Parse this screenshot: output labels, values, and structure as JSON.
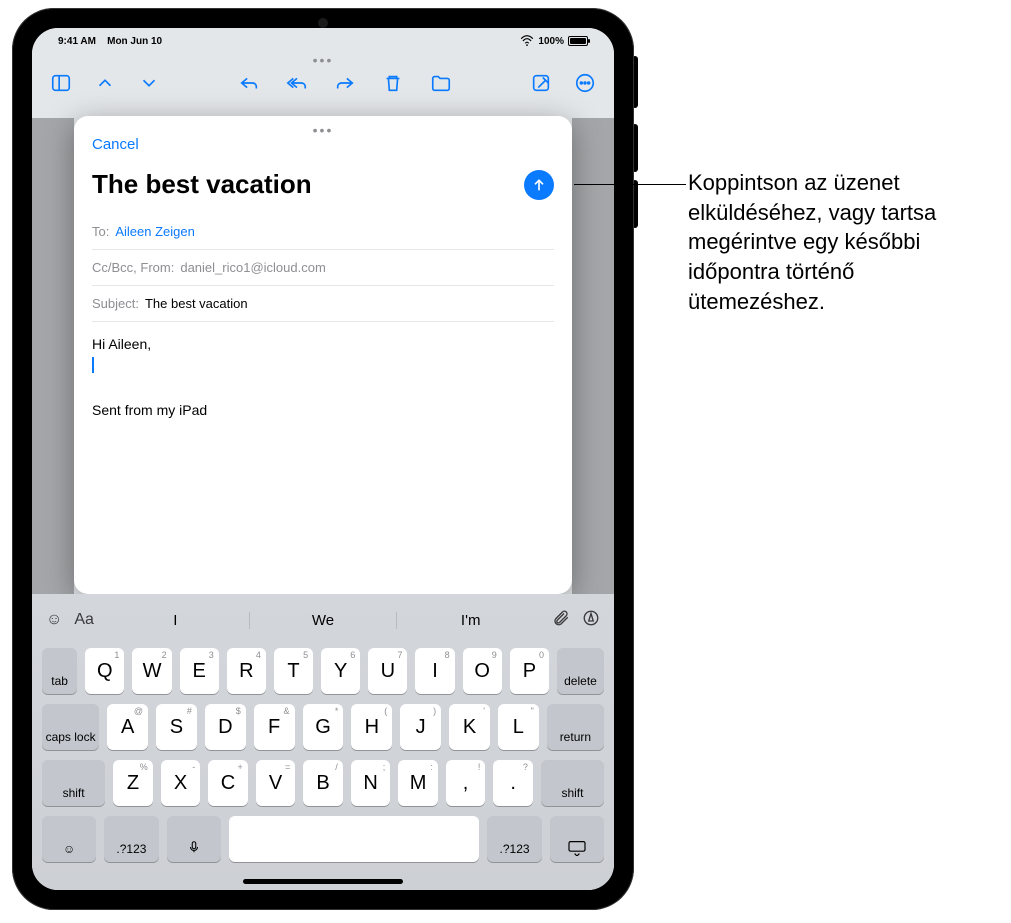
{
  "statusbar": {
    "time": "9:41 AM",
    "date": "Mon Jun 10",
    "battery_pct": "100%"
  },
  "toolbar": {
    "icons": [
      "sidebar",
      "chevron-up",
      "chevron-down",
      "reply",
      "reply-all",
      "forward",
      "trash",
      "folder",
      "compose",
      "more"
    ]
  },
  "compose": {
    "cancel": "Cancel",
    "title": "The best vacation",
    "to_label": "To:",
    "to_value": "Aileen Zeigen",
    "ccbcc_label": "Cc/Bcc, From:",
    "ccbcc_value": "daniel_rico1@icloud.com",
    "subject_label": "Subject:",
    "subject_value": "The best vacation",
    "body_greeting": "Hi Aileen,",
    "signature": "Sent from my iPad"
  },
  "keyboard": {
    "format_label": "Aa",
    "suggestions": [
      "I",
      "We",
      "I'm"
    ],
    "row1": [
      {
        "k": "Q",
        "s": "1"
      },
      {
        "k": "W",
        "s": "2"
      },
      {
        "k": "E",
        "s": "3"
      },
      {
        "k": "R",
        "s": "4"
      },
      {
        "k": "T",
        "s": "5"
      },
      {
        "k": "Y",
        "s": "6"
      },
      {
        "k": "U",
        "s": "7"
      },
      {
        "k": "I",
        "s": "8"
      },
      {
        "k": "O",
        "s": "9"
      },
      {
        "k": "P",
        "s": "0"
      }
    ],
    "row2": [
      {
        "k": "A",
        "s": "@"
      },
      {
        "k": "S",
        "s": "#"
      },
      {
        "k": "D",
        "s": "$"
      },
      {
        "k": "F",
        "s": "&"
      },
      {
        "k": "G",
        "s": "*"
      },
      {
        "k": "H",
        "s": "("
      },
      {
        "k": "J",
        "s": ")"
      },
      {
        "k": "K",
        "s": "'"
      },
      {
        "k": "L",
        "s": "\""
      }
    ],
    "row3": [
      {
        "k": "Z",
        "s": "%"
      },
      {
        "k": "X",
        "s": "-"
      },
      {
        "k": "C",
        "s": "+"
      },
      {
        "k": "V",
        "s": "="
      },
      {
        "k": "B",
        "s": "/"
      },
      {
        "k": "N",
        "s": ";"
      },
      {
        "k": "M",
        "s": ":"
      },
      {
        "k": ",",
        "s": "!"
      },
      {
        "k": ".",
        "s": "?"
      }
    ],
    "tab": "tab",
    "delete": "delete",
    "caps": "caps lock",
    "return": "return",
    "shift": "shift",
    "numsym": ".?123"
  },
  "callout": {
    "text": "Koppintson az üzenet elküldéséhez, vagy tartsa megérintve egy későbbi időpontra történő ütemezéshez."
  }
}
